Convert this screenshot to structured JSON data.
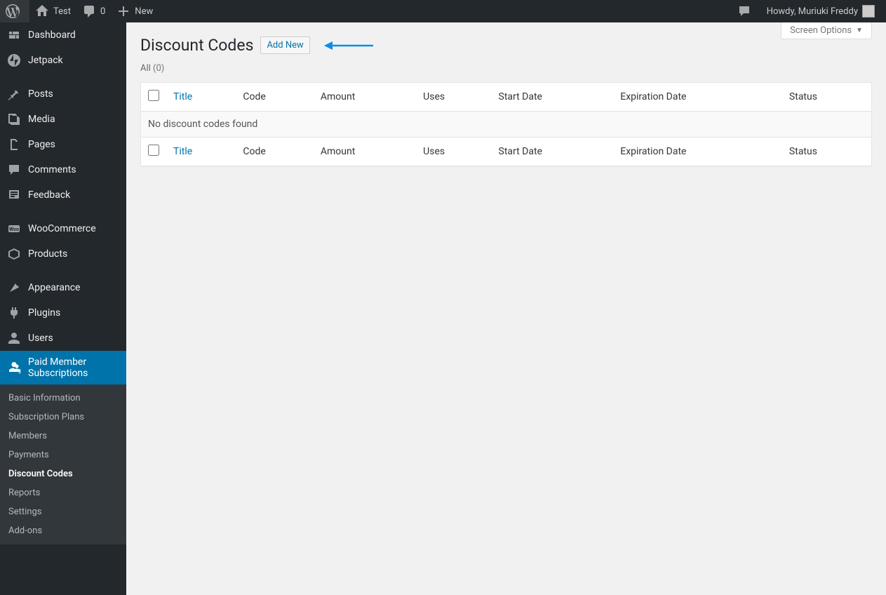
{
  "adminbar": {
    "site_name": "Test",
    "comments_count": "0",
    "new_label": "New",
    "howdy_text": "Howdy, Muriuki Freddy"
  },
  "sidebar": {
    "items": [
      {
        "icon": "dashboard",
        "label": "Dashboard"
      },
      {
        "icon": "jetpack",
        "label": "Jetpack"
      },
      {
        "sep": true
      },
      {
        "icon": "pin",
        "label": "Posts"
      },
      {
        "icon": "media",
        "label": "Media"
      },
      {
        "icon": "page",
        "label": "Pages"
      },
      {
        "icon": "comment",
        "label": "Comments"
      },
      {
        "icon": "feedback",
        "label": "Feedback"
      },
      {
        "sep": true
      },
      {
        "icon": "woo",
        "label": "WooCommerce"
      },
      {
        "icon": "product",
        "label": "Products"
      },
      {
        "sep": true
      },
      {
        "icon": "appearance",
        "label": "Appearance"
      },
      {
        "icon": "plugin",
        "label": "Plugins"
      },
      {
        "icon": "user",
        "label": "Users"
      },
      {
        "icon": "pms",
        "label": "Paid Member Subscriptions",
        "active": true
      }
    ],
    "submenu": [
      {
        "label": "Basic Information"
      },
      {
        "label": "Subscription Plans"
      },
      {
        "label": "Members"
      },
      {
        "label": "Payments"
      },
      {
        "label": "Discount Codes",
        "current": true
      },
      {
        "label": "Reports"
      },
      {
        "label": "Settings"
      },
      {
        "label": "Add-ons"
      }
    ]
  },
  "page": {
    "title": "Discount Codes",
    "add_new": "Add New",
    "screen_options": "Screen Options",
    "filter_all": "All",
    "filter_count": "(0)",
    "empty_message": "No discount codes found",
    "columns": {
      "title": "Title",
      "code": "Code",
      "amount": "Amount",
      "uses": "Uses",
      "start_date": "Start Date",
      "expiration_date": "Expiration Date",
      "status": "Status"
    }
  }
}
